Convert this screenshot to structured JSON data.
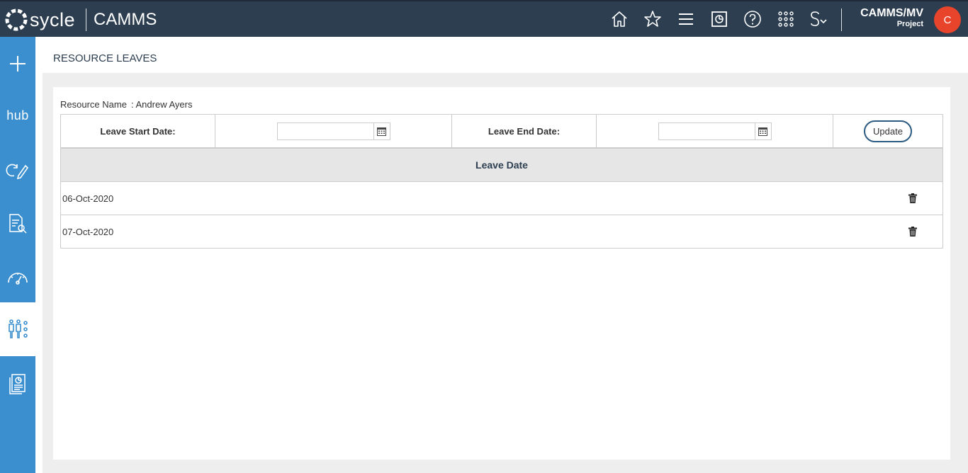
{
  "header": {
    "brand": "sycle",
    "app_title": "CAMMS",
    "user_name": "CAMMS/MV",
    "user_role": "Project",
    "avatar_initial": "C",
    "icons": [
      "home-icon",
      "star-icon",
      "menu-icon",
      "dashboard-icon",
      "help-icon",
      "apps-grid-icon",
      "strategy-dropdown-icon"
    ]
  },
  "sidebar": {
    "items": [
      {
        "name": "add-icon"
      },
      {
        "name": "hub-logo",
        "label": "hub"
      },
      {
        "name": "refresh-edit-icon"
      },
      {
        "name": "document-search-icon"
      },
      {
        "name": "gauge-icon"
      },
      {
        "name": "resource-settings-icon",
        "active": true
      },
      {
        "name": "report-icon"
      }
    ]
  },
  "page": {
    "title": "RESOURCE LEAVES",
    "resource_label": "Resource Name",
    "resource_value": ": Andrew Ayers"
  },
  "filter": {
    "start_label": "Leave Start Date:",
    "start_value": "",
    "end_label": "Leave End Date:",
    "end_value": "",
    "update_label": "Update"
  },
  "grid": {
    "header": "Leave Date",
    "rows": [
      {
        "date": "06-Oct-2020"
      },
      {
        "date": "07-Oct-2020"
      }
    ]
  },
  "colors": {
    "topbar": "#2c3e50",
    "sidebar": "#3b8fce",
    "avatar": "#e8442c",
    "accent_text": "#2c3e50"
  }
}
